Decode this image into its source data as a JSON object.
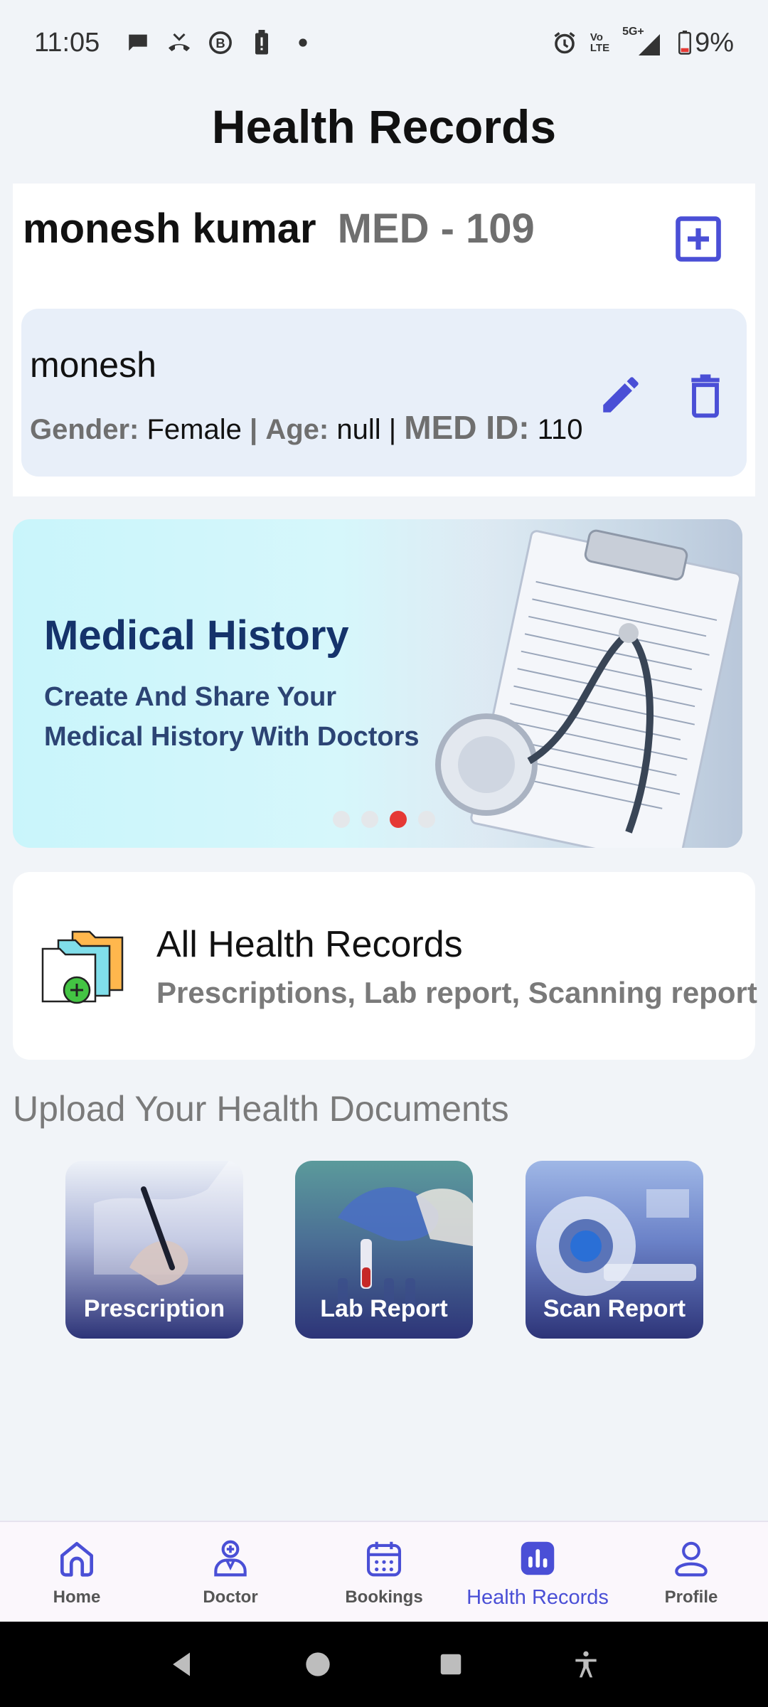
{
  "status_bar": {
    "time": "11:05",
    "battery_percent": "9%",
    "network": "5G+",
    "volte": [
      "Vo",
      "LTE"
    ]
  },
  "header": {
    "title": "Health Records"
  },
  "profile": {
    "name": "monesh kumar",
    "med_id": "MED - 109",
    "member": {
      "name": "monesh",
      "gender_label": "Gender:",
      "gender_value": "Female",
      "age_label": "Age:",
      "age_value": "null",
      "separator": "|",
      "med_id_label": "MED ID:",
      "med_id_value": "110"
    }
  },
  "banner": {
    "title": "Medical History",
    "subtitle": "Create And Share Your Medical History With Doctors",
    "slide_count": 4,
    "active_slide": 3
  },
  "records": {
    "title": "All Health Records",
    "subtitle": "Prescriptions, Lab report, Scanning report"
  },
  "upload": {
    "heading": "Upload Your Health Documents",
    "tiles": [
      {
        "label": "Prescription"
      },
      {
        "label": "Lab Report"
      },
      {
        "label": "Scan Report"
      }
    ]
  },
  "nav": {
    "items": [
      {
        "label": "Home",
        "icon": "home-icon"
      },
      {
        "label": "Doctor",
        "icon": "doctor-icon"
      },
      {
        "label": "Bookings",
        "icon": "calendar-icon"
      },
      {
        "label": "Health Records",
        "icon": "health-records-icon",
        "active": true
      },
      {
        "label": "Profile",
        "icon": "profile-icon"
      }
    ]
  },
  "colors": {
    "accent": "#4a4fd6",
    "banner_title": "#15336b",
    "active_dot": "#e53935",
    "tile_bottom": "#2d3478"
  }
}
